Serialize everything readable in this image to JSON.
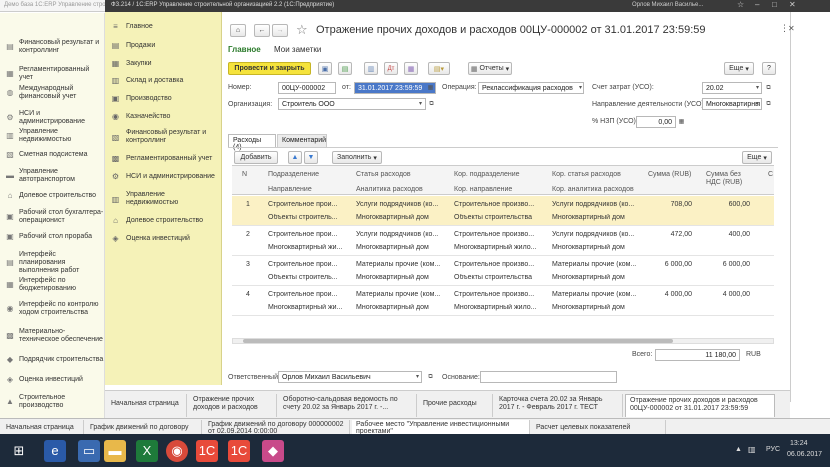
{
  "back_window": {
    "title": "Демо база 1С:ERP Управление строител...",
    "sidebar": [
      "Финансовый результат и контроллинг",
      "Регламентированный учет",
      "Международный финансовый учет",
      "НСИ и администрирование",
      "Управление недвижимостью",
      "Сметная подсистема",
      "Управление автотранспортом",
      "Долевое строительство",
      "Рабочий стол бухгалтера-операционист",
      "Рабочий стол прораба",
      "Интерфейс планирования выполнения работ",
      "Интерфейс по бюджетированию",
      "Интерфейс по контролю ходом строительства",
      "Материально-техническое обеспечение",
      "Подрядчик строительства",
      "Оценка инвестиций",
      "Строительное производство"
    ]
  },
  "window": {
    "title": "ФЗ.214 / 1С:ERP Управление строительной организацией 2.2 (1С:Предприятие)",
    "user": "Орлов Михаил Василье...",
    "controls": [
      "▭",
      "☆",
      "–",
      "□",
      "✕"
    ]
  },
  "sidebar": {
    "items": [
      "Главное",
      "Продажи",
      "Закупки",
      "Склад и доставка",
      "Производство",
      "Казначейство",
      "Финансовый результат и контроллинг",
      "Регламентированный учет",
      "НСИ и администрирование",
      "Управление недвижимостью",
      "Долевое строительство",
      "Оценка инвестиций"
    ]
  },
  "document": {
    "title": "Отражение прочих доходов и расходов 00ЦУ-000002 от 31.01.2017 23:59:59",
    "nav_tabs": [
      "Главное",
      "Мои заметки"
    ],
    "toolbar": {
      "post_close": "Провести и закрыть",
      "reports": "Отчеты",
      "more": "Еще",
      "help": "?"
    },
    "fields": {
      "number_label": "Номер:",
      "number": "00ЦУ-000002",
      "from_label": "от:",
      "date": "31.01.2017 23:59:59",
      "operation_label": "Операция:",
      "operation": "Реклассификация расходов",
      "cost_account_label": "Счет затрат (УСО):",
      "cost_account": "20.02",
      "org_label": "Организация:",
      "org": "Строитель ООО",
      "activity_label": "Направление деятельности (УСО):",
      "activity": "Многоквартирны",
      "nzp_label": "% НЗП (УСО):",
      "nzp": "0,00"
    },
    "inner_tabs": [
      "Расходы (4)",
      "Комментарий"
    ],
    "table_toolbar": {
      "add": "Добавить",
      "fill": "Заполнить",
      "more": "Еще"
    },
    "table": {
      "headers_top": [
        "N",
        "Подразделение",
        "Статья расходов",
        "Кор. подразделение",
        "Кор. статья расходов",
        "Сумма (RUB)",
        "Сумма без НДС (RUB)",
        "С"
      ],
      "headers_bottom": [
        "Направление",
        "Аналитика расходов",
        "Кор. направление",
        "Кор. аналитика расходов"
      ],
      "rows": [
        {
          "n": "1",
          "dept": "Строительное прои...",
          "item": "Услуги подрядчиков (ко...",
          "cor_dept": "Строительное произво...",
          "cor_item": "Услуги подрядчиков (ко...",
          "sum": "708,00",
          "net": "600,00",
          "dir": "Объекты строитель...",
          "anal": "Многоквартирный дом",
          "cor_dir": "Объекты строительства",
          "cor_anal": "Многоквартирный дом"
        },
        {
          "n": "2",
          "dept": "Строительное прои...",
          "item": "Услуги подрядчиков (ко...",
          "cor_dept": "Строительное произво...",
          "cor_item": "Услуги подрядчиков (ко...",
          "sum": "472,00",
          "net": "400,00",
          "dir": "Многоквартирный жи...",
          "anal": "Многоквартирный дом",
          "cor_dir": "Многоквартирный жило...",
          "cor_anal": "Многоквартирный дом"
        },
        {
          "n": "3",
          "dept": "Строительное прои...",
          "item": "Материалы прочие (ком...",
          "cor_dept": "Строительное произво...",
          "cor_item": "Материалы прочие (ком...",
          "sum": "6 000,00",
          "net": "6 000,00",
          "dir": "Объекты строитель...",
          "anal": "Многоквартирный дом",
          "cor_dir": "Объекты строительства",
          "cor_anal": "Многоквартирный дом"
        },
        {
          "n": "4",
          "dept": "Строительное прои...",
          "item": "Материалы прочие (ком...",
          "cor_dept": "Строительное произво...",
          "cor_item": "Материалы прочие (ком...",
          "sum": "4 000,00",
          "net": "4 000,00",
          "dir": "Многоквартирный жи...",
          "anal": "Многоквартирный дом",
          "cor_dir": "Многоквартирный жило...",
          "cor_anal": "Многоквартирный дом"
        }
      ]
    },
    "total_label": "Всего:",
    "total": "11 180,00",
    "currency": "RUB",
    "responsible_label": "Ответственный:",
    "responsible": "Орлов Михаил Васильевич",
    "basis_label": "Основание:",
    "basis": ""
  },
  "bottom_tabs": [
    "Начальная страница",
    "Отражение прочих доходов и расходов",
    "Оборотно-сальдовая ведомость по счету 20.02 за Январь 2017 г. -...",
    "Прочие расходы",
    "Карточка счета 20.02 за Январь 2017 г. - Февраль 2017 г. ТЕСТ",
    "Отражение прочих доходов и расходов 00ЦУ-000002 от 31.01.2017 23:59:59"
  ],
  "outer_tabs": [
    "Начальная страница",
    "График движений по договору",
    "График движений по договору 000000002 от 02.09.2014 0:00:00",
    "Рабочее место \"Управление инвестиционными проектами\"",
    "Расчет целевых показателей"
  ],
  "taskbar": {
    "lang": "РУС",
    "time": "13:24",
    "date": "06.06.2017"
  }
}
